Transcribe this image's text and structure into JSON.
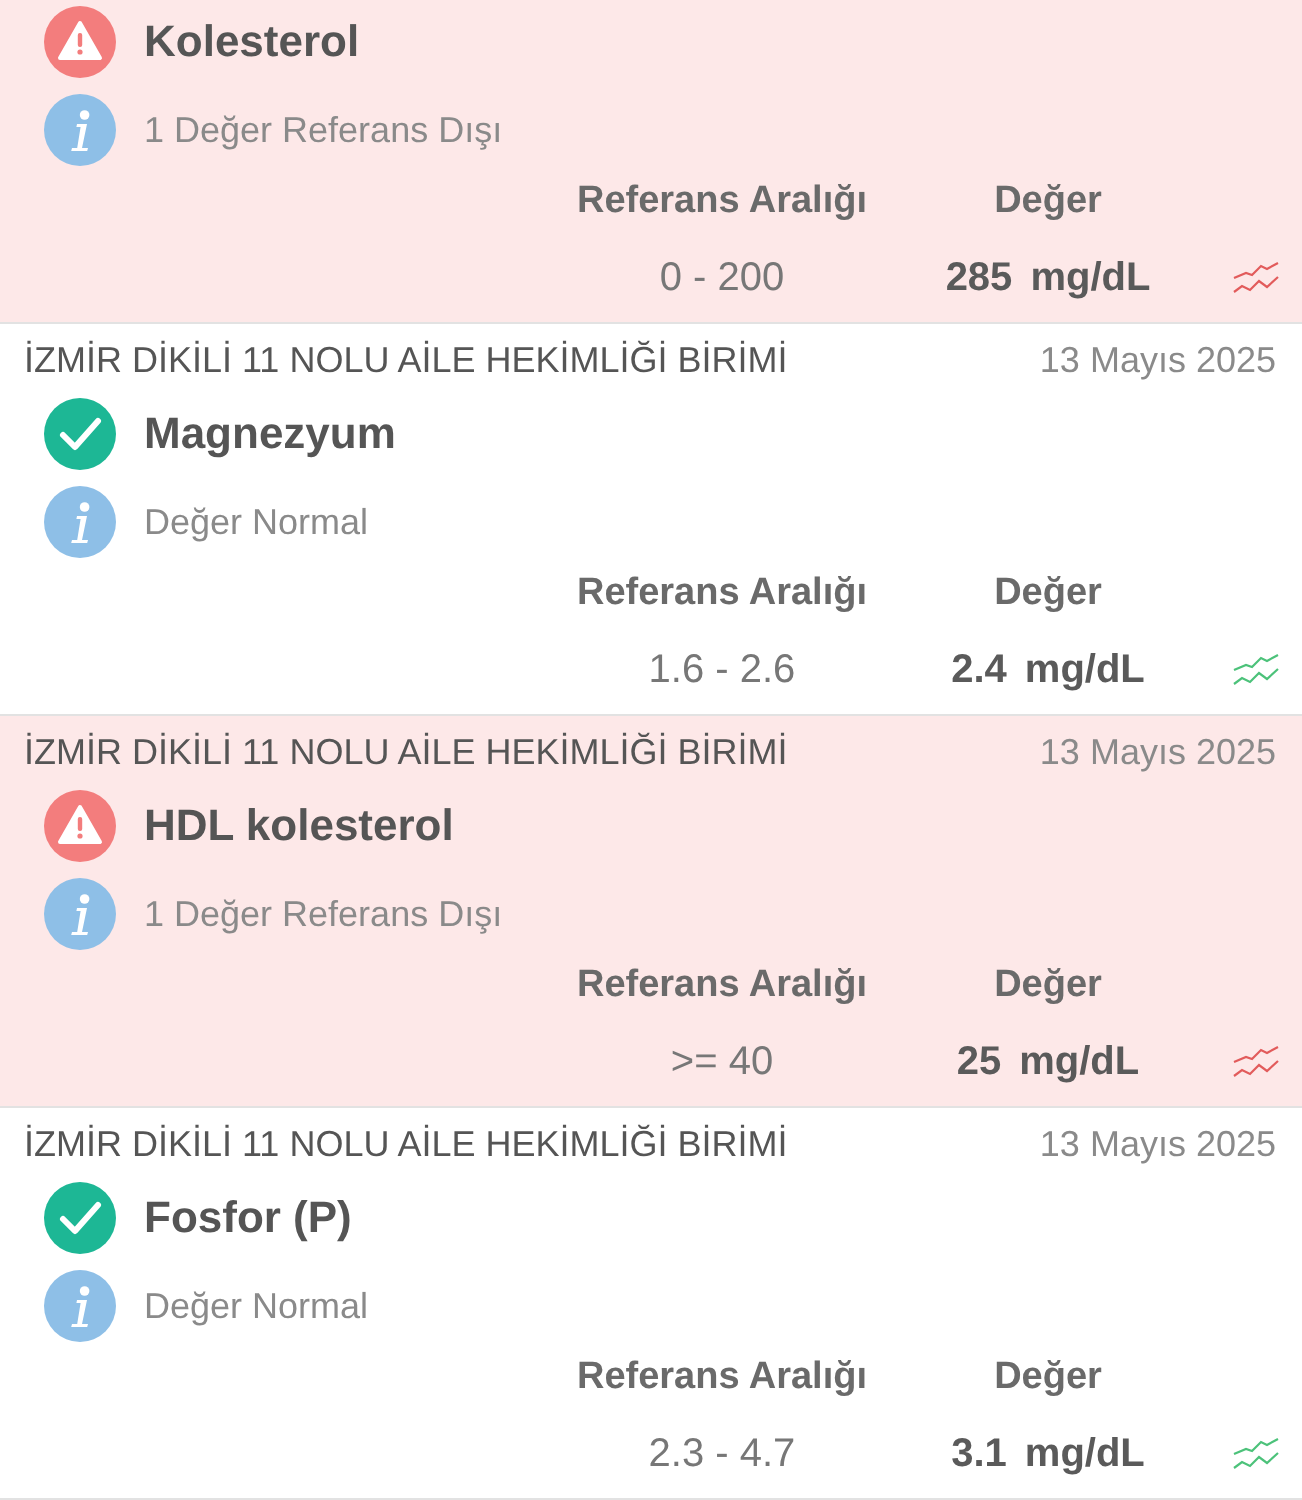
{
  "results": [
    {
      "kind": "abnormal",
      "name": "Kolesterol",
      "note": "1 Değer Referans Dışı",
      "reference_label": "Referans Aralığı",
      "value_label": "Değer",
      "reference": "0 - 200",
      "value": "285",
      "unit": "mg/dL"
    },
    {
      "clinic": "İZMİR DİKİLİ 11 NOLU AİLE HEKİMLİĞİ BİRİMİ",
      "date": "13 Mayıs 2025",
      "kind": "normal",
      "name": "Magnezyum",
      "note": "Değer Normal",
      "reference_label": "Referans Aralığı",
      "value_label": "Değer",
      "reference": "1.6 - 2.6",
      "value": "2.4",
      "unit": "mg/dL"
    },
    {
      "clinic": "İZMİR DİKİLİ 11 NOLU AİLE HEKİMLİĞİ BİRİMİ",
      "date": "13 Mayıs 2025",
      "kind": "abnormal",
      "name": "HDL kolesterol",
      "note": "1 Değer Referans Dışı",
      "reference_label": "Referans Aralığı",
      "value_label": "Değer",
      "reference": ">= 40",
      "value": "25",
      "unit": "mg/dL"
    },
    {
      "clinic": "İZMİR DİKİLİ 11 NOLU AİLE HEKİMLİĞİ BİRİMİ",
      "date": "13 Mayıs 2025",
      "kind": "normal",
      "name": "Fosfor (P)",
      "note": "Değer Normal",
      "reference_label": "Referans Aralığı",
      "value_label": "Değer",
      "reference": "2.3 - 4.7",
      "value": "3.1",
      "unit": "mg/dL"
    }
  ]
}
